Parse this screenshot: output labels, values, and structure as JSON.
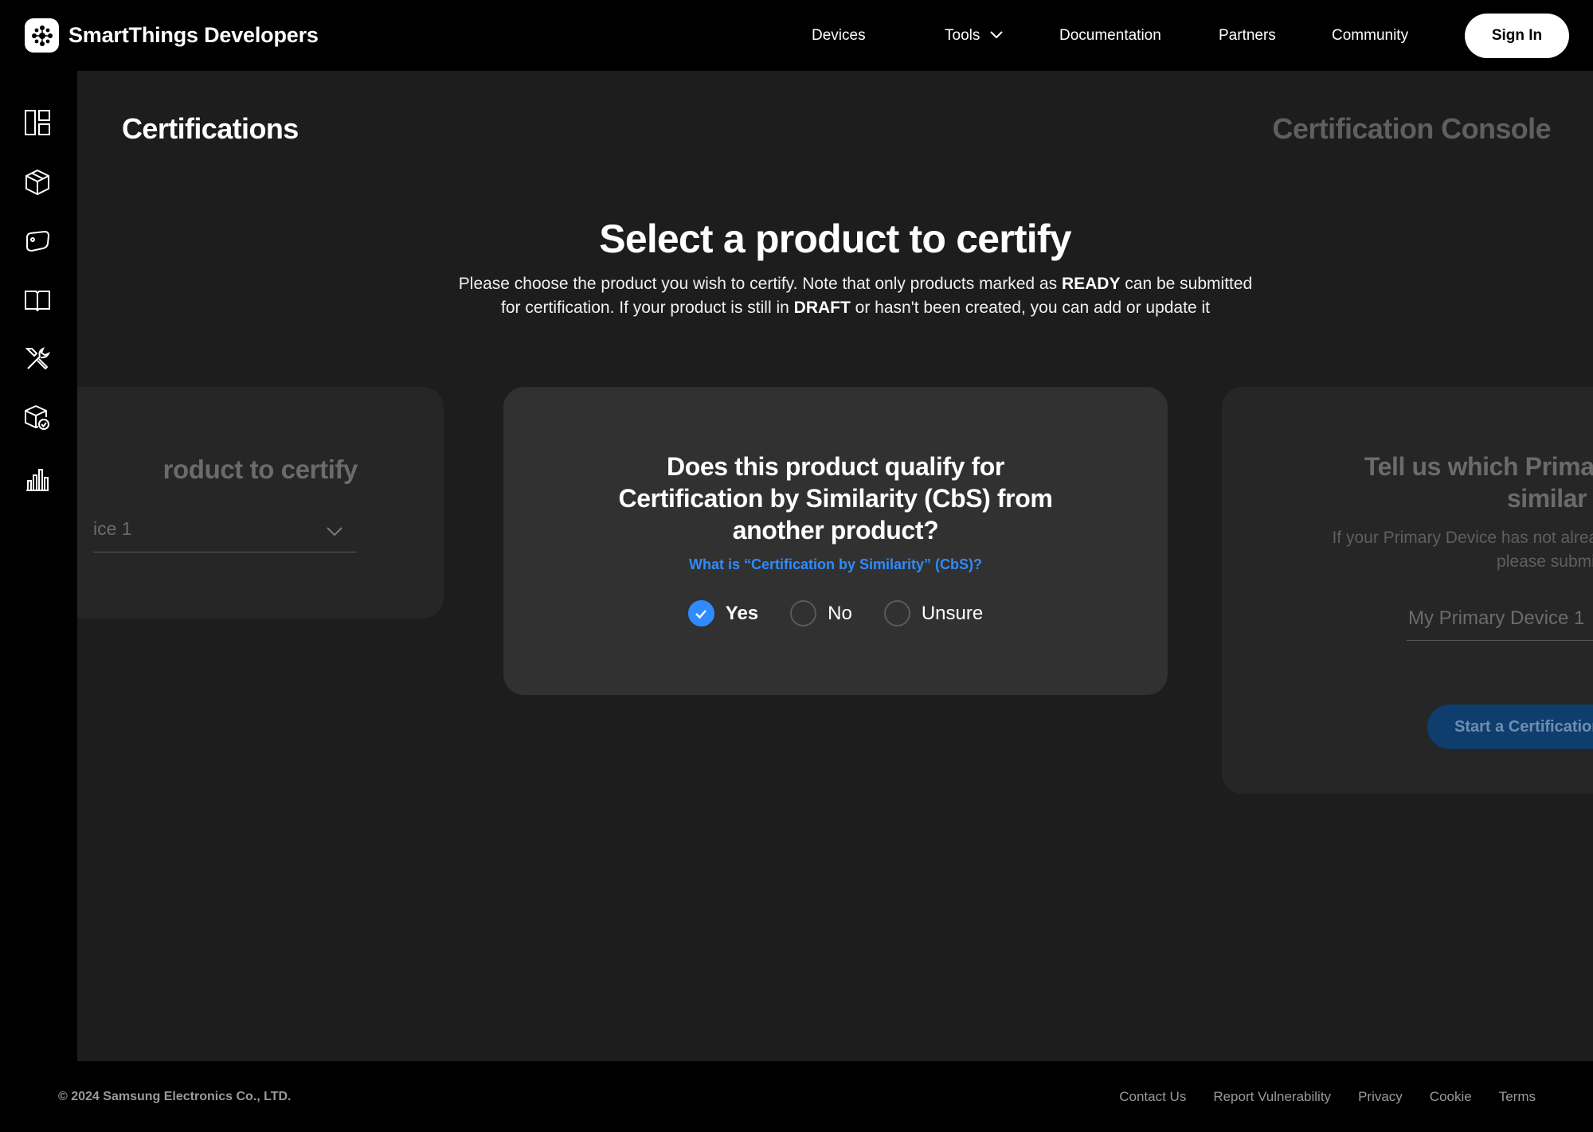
{
  "header": {
    "brand": "SmartThings Developers",
    "nav": {
      "devices": "Devices",
      "tools": "Tools",
      "documentation": "Documentation",
      "partners": "Partners",
      "community": "Community"
    },
    "sign_in": "Sign In"
  },
  "sidebar": {
    "icons": [
      "dashboard-icon",
      "cube-icon",
      "tag-icon",
      "book-icon",
      "tools-icon",
      "certified-box-icon",
      "analytics-icon"
    ]
  },
  "main": {
    "page_title": "Certifications",
    "console_title": "Certification Console",
    "hero": {
      "title": "Select a product to certify",
      "desc_part1": "Please choose the product you wish to certify. Note that only products marked as ",
      "desc_ready": "READY",
      "desc_part2": " can be submitted for certification. If your product is still in ",
      "desc_draft": "DRAFT",
      "desc_part3": " or hasn't been created, you can add or update it"
    },
    "left_card": {
      "heading": "roduct to certify",
      "select_value": "ice 1"
    },
    "center_card": {
      "question": "Does this product qualify for Certification by Similarity (CbS) from another product?",
      "link": "What is “Certification by Similarity” (CbS)?",
      "options": [
        "Yes",
        "No",
        "Unsure"
      ],
      "selected": "Yes"
    },
    "right_card": {
      "heading": "Tell us which Primary device is similar",
      "desc": "If your Primary Device has not already received certification, please submit it",
      "field_value": "My Primary Device 1",
      "button": "Start a Certification"
    }
  },
  "footer": {
    "copyright": "© 2024 Samsung Electronics Co., LTD.",
    "links": [
      "Contact Us",
      "Report Vulnerability",
      "Privacy",
      "Cookie",
      "Terms"
    ]
  },
  "colors": {
    "accent": "#2f8bff",
    "background": "#1d1d1d",
    "card": "#313131"
  }
}
